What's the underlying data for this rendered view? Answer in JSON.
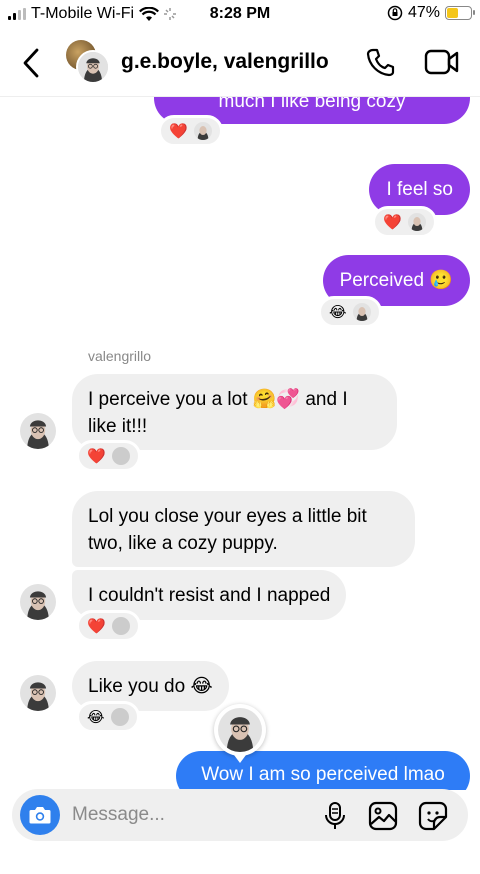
{
  "status": {
    "carrier": "T-Mobile Wi-Fi",
    "time": "8:28 PM",
    "battery": "47%",
    "battery_level": 0.47
  },
  "header": {
    "title": "g.e.boyle, valengrillo",
    "icons": [
      "back-chevron-icon",
      "phone-icon",
      "video-icon"
    ]
  },
  "messages": {
    "sent1": {
      "text": "much I like being cozy",
      "reactions": "❤️"
    },
    "sent2": {
      "text": "I feel so",
      "reactions": "❤️"
    },
    "sent3": {
      "text": "Perceived 🥲",
      "reactions": "😂"
    },
    "sender_name": "valengrillo",
    "recv1": {
      "text": "I perceive you a lot 🤗💞 and I like it!!!",
      "reactions": "❤️"
    },
    "recv2": {
      "text": "Lol you close your eyes a little bit two, like a cozy puppy."
    },
    "recv3": {
      "text": "I couldn't resist and I napped",
      "reactions": "❤️"
    },
    "recv4": {
      "text": "Like you do 😂",
      "reactions": "😂"
    },
    "sent4": {
      "text": "Wow I am so perceived lmao"
    }
  },
  "composer": {
    "placeholder": "Message...",
    "icons": [
      "camera-icon",
      "microphone-icon",
      "gallery-icon",
      "sticker-icon"
    ]
  },
  "colors": {
    "sent_purple": "#8f3be6",
    "sent_blue": "#2e7cf6",
    "received_gray": "#efefef",
    "camera_blue": "#2f80ed"
  }
}
